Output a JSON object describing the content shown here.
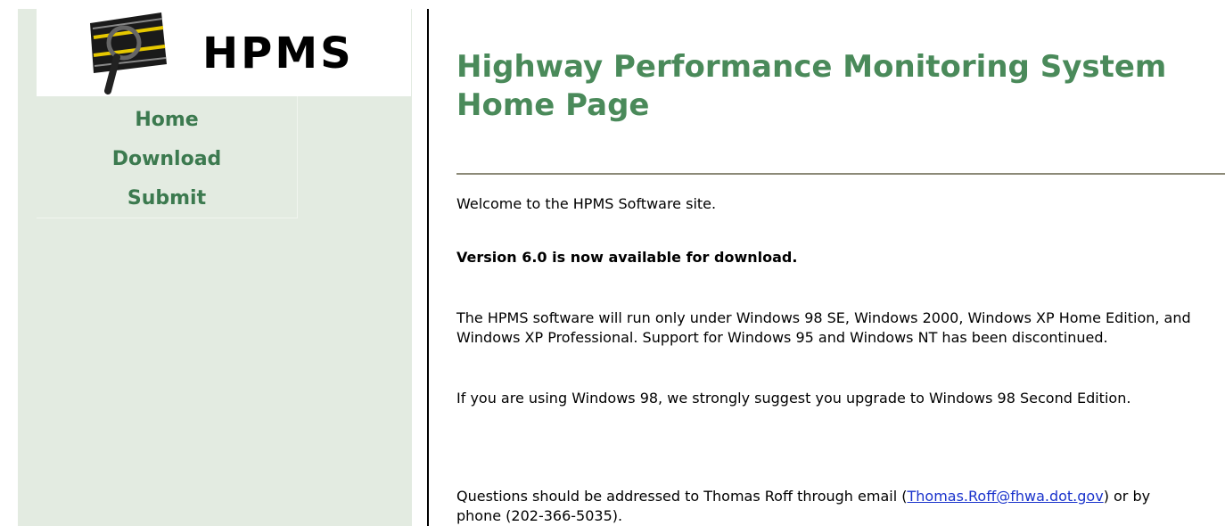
{
  "logo": {
    "text": "HPMS"
  },
  "nav": {
    "items": [
      "Home",
      "Download",
      "Submit"
    ]
  },
  "main": {
    "title": "Highway Performance Monitoring System Home Page",
    "welcome": "Welcome to the HPMS Software site.",
    "version_notice": "Version 6.0 is now available for download.",
    "requirements": "The HPMS software will run only under Windows 98 SE, Windows 2000, Windows XP Home Edition, and Windows XP Professional. Support for Windows 95 and Windows NT has been discontinued.",
    "upgrade_advice": "If you are using Windows 98, we strongly suggest you upgrade to Windows 98 Second Edition.",
    "contact": {
      "prefix": "Questions should be addressed to Thomas Roff through email (",
      "email": "Thomas.Roff@fhwa.dot.gov",
      "suffix": ") or by phone (202-366-5035)."
    }
  },
  "colors": {
    "sidebar_bg": "#e3ebe1",
    "nav_link": "#3c7a4f",
    "title": "#4a8a5a",
    "rule": "#8c8a78",
    "email_link": "#1a33cc"
  },
  "icons": {
    "logo_icon": "road-magnifier-icon"
  }
}
